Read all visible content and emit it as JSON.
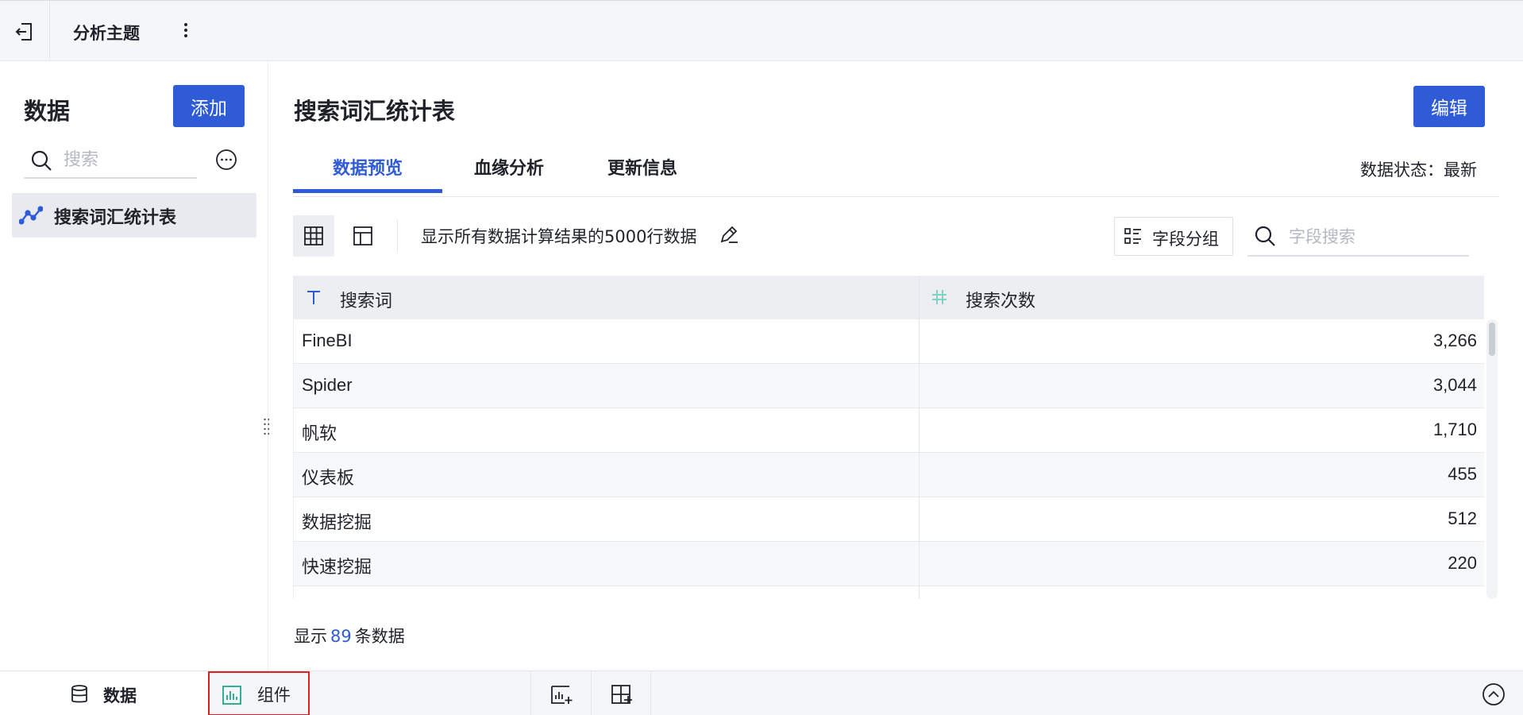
{
  "topbar": {
    "title": "分析主题"
  },
  "sidebar": {
    "title": "数据",
    "add_label": "添加",
    "search_placeholder": "搜索",
    "items": [
      {
        "label": "搜索词汇统计表"
      }
    ]
  },
  "main": {
    "title": "搜索词汇统计表",
    "edit_label": "编辑",
    "tabs": [
      {
        "label": "数据预览"
      },
      {
        "label": "血缘分析"
      },
      {
        "label": "更新信息"
      }
    ],
    "data_status": "数据状态：最新",
    "preview_text": "显示所有数据计算结果的5000行数据",
    "group_label": "字段分组",
    "field_search_placeholder": "字段搜索",
    "table": {
      "columns": [
        {
          "label": "搜索词",
          "type": "text"
        },
        {
          "label": "搜索次数",
          "type": "number"
        }
      ],
      "rows": [
        {
          "term": "FineBI",
          "count": "3,266"
        },
        {
          "term": "Spider",
          "count": "3,044"
        },
        {
          "term": "帆软",
          "count": "1,710"
        },
        {
          "term": "仪表板",
          "count": "455"
        },
        {
          "term": "数据挖掘",
          "count": "512"
        },
        {
          "term": "快速挖掘",
          "count": "220"
        }
      ]
    },
    "footer": {
      "prefix": "显示",
      "count": "89",
      "suffix": "条数据"
    }
  },
  "bottombar": {
    "data_tab": "数据",
    "component_tab": "组件"
  },
  "colors": {
    "accent": "#2f5bd7",
    "highlight_border": "#e02020"
  }
}
